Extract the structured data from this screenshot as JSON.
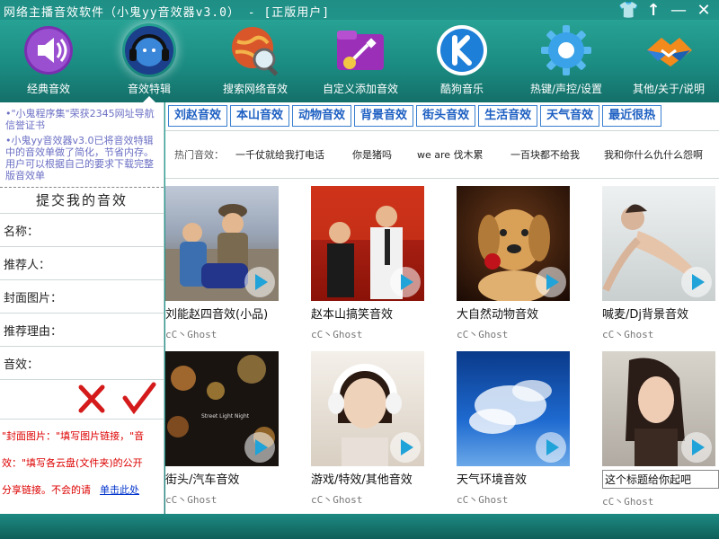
{
  "window": {
    "title": "网络主播音效软件（小鬼yy音效器v3.0） - [正版用户]",
    "controls": {
      "skin": "👕",
      "up": "↑",
      "min": "—",
      "close": "✕"
    }
  },
  "toolbar": {
    "items": [
      {
        "label": "经典音效",
        "icon": "speaker-icon",
        "active": false
      },
      {
        "label": "音效特辑",
        "icon": "headphone-man-icon",
        "active": true
      },
      {
        "label": "搜索网络音效",
        "icon": "globe-search-icon",
        "active": false
      },
      {
        "label": "自定义添加音效",
        "icon": "guitar-folder-icon",
        "active": false
      },
      {
        "label": "酷狗音乐",
        "icon": "kugou-icon",
        "active": false
      },
      {
        "label": "热键/声控/设置",
        "icon": "gear-icon",
        "active": false
      },
      {
        "label": "其他/关于/说明",
        "icon": "handshake-icon",
        "active": false
      }
    ]
  },
  "sidebar": {
    "notices": [
      "•\"小鬼程序集\"荣获2345网址导航信誉证书",
      "•小鬼yy音效器v3.0已将音效特辑中的音效单做了简化，节省内存。用户可以根据自己的要求下载完整版音效单"
    ],
    "form_title": "提交我的音效",
    "fields": [
      "名称：",
      "推荐人：",
      "封面图片：",
      "推荐理由：",
      "音效："
    ],
    "hints": [
      "\"封面图片：\"填写图片链接，\"音",
      "效：\"填写各云盘(文件夹)的公开",
      "分享链接。不会的请"
    ],
    "hint_link": "单击此处"
  },
  "tabs": [
    "刘赵音效",
    "本山音效",
    "动物音效",
    "背景音效",
    "街头音效",
    "生活音效",
    "天气音效",
    "最近很热"
  ],
  "hot": {
    "label": "热门音效：",
    "items": [
      "一千仗就给我打电话",
      "你是猪吗",
      "we are 伐木累",
      "一百块都不给我",
      "我和你什么仇什么怨啊"
    ]
  },
  "cards": [
    {
      "title": "刘能赵四音效(小品)",
      "author": "cC丶Ghost"
    },
    {
      "title": "赵本山搞笑音效",
      "author": "cC丶Ghost"
    },
    {
      "title": "大自然动物音效",
      "author": "cC丶Ghost"
    },
    {
      "title": "喊麦/Dj背景音效",
      "author": "cC丶Ghost"
    },
    {
      "title": "街头/汽车音效",
      "author": "cC丶Ghost"
    },
    {
      "title": "游戏/特效/其他音效",
      "author": "cC丶Ghost"
    },
    {
      "title": "天气环境音效",
      "author": "cC丶Ghost"
    },
    {
      "title": "这个标题给你起吧",
      "author": "cC丶Ghost"
    }
  ],
  "street_sign": "Street Light Night"
}
